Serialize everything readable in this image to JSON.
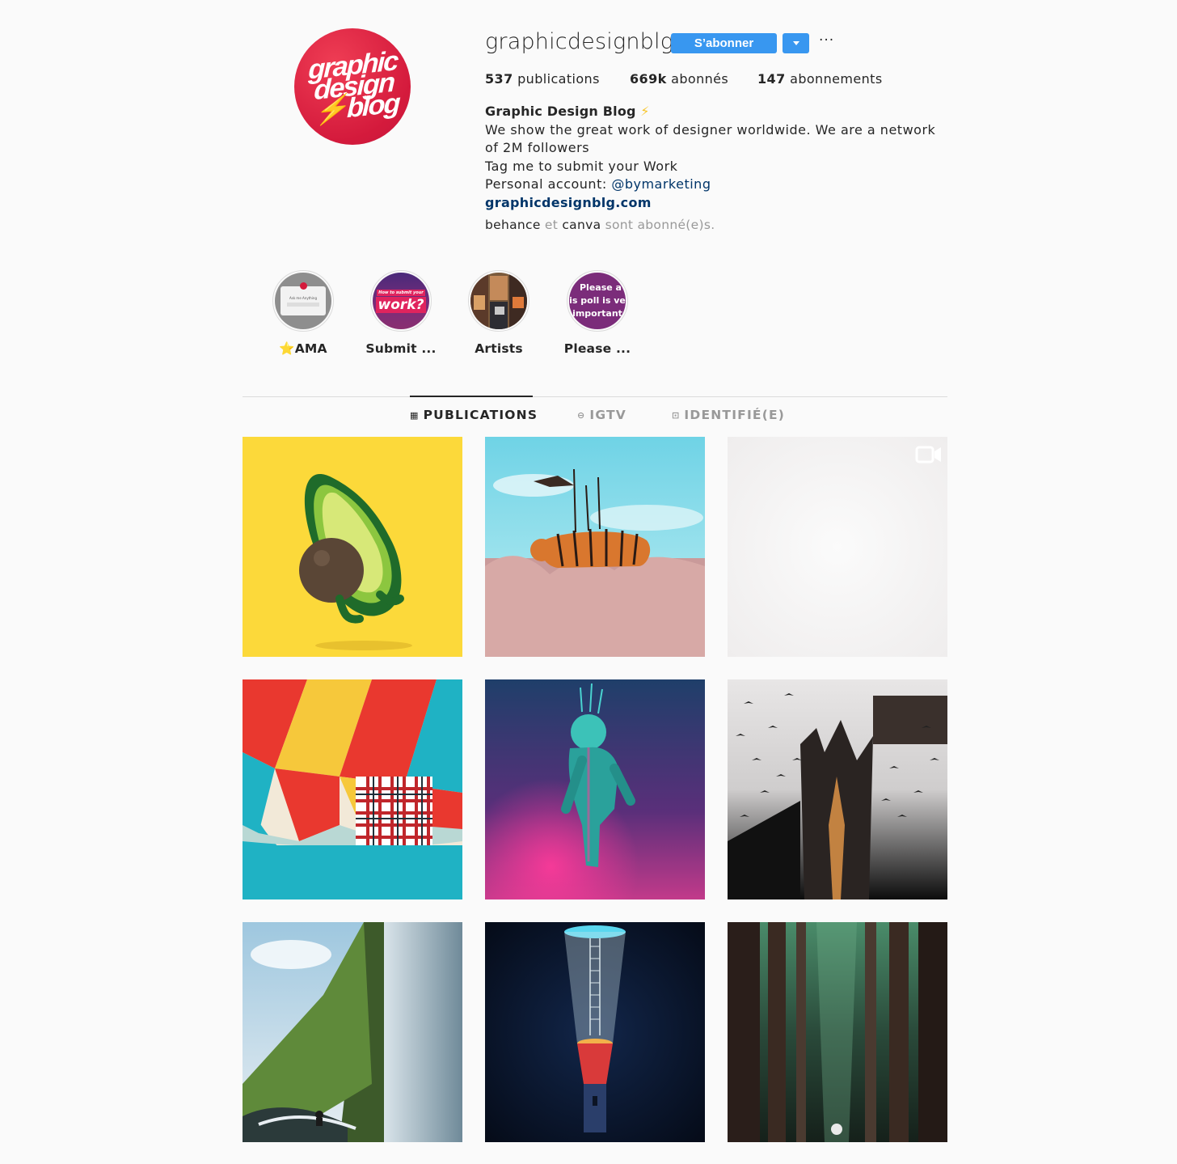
{
  "profile": {
    "avatar_text": [
      "graphic",
      "design",
      "blog"
    ],
    "username": "graphicdesignblg",
    "follow_label": "S’abonner",
    "more_label": "···",
    "stats": {
      "posts_count": "537",
      "posts_label": "publications",
      "followers_count": "669k",
      "followers_label": "abonnés",
      "following_count": "147",
      "following_label": "abonnements"
    },
    "bio": {
      "name": "Graphic Design Blog",
      "name_emoji": "⚡",
      "line1": "We show the great work of designer worldwide. We are a network",
      "line2": "of 2M followers",
      "line3": "Tag me to submit your Work",
      "line4_prefix": "Personal account: ",
      "line4_mention": "@bymarketing",
      "website": "graphicdesignblg.com"
    },
    "followed_by": {
      "user1": "behance",
      "connector": " et ",
      "user2": "canva",
      "suffix": " sont abonné(e)s."
    }
  },
  "highlights": [
    {
      "label": "⭐AMA",
      "cover_text": "Ask me Anything"
    },
    {
      "label": "Submit ...",
      "cover_small": "How to submit your",
      "cover_big": "work?"
    },
    {
      "label": "Artists"
    },
    {
      "label": "Please ...",
      "cover_lines": [
        "Please a",
        "is poll is ve",
        "important"
      ]
    }
  ],
  "tabs": [
    {
      "label": "PUBLICATIONS",
      "icon": "grid-icon",
      "active": true
    },
    {
      "label": "IGTV",
      "icon": "igtv-icon",
      "active": false
    },
    {
      "label": "IDENTIFIÉ(E)",
      "icon": "tagged-icon",
      "active": false
    }
  ],
  "posts": [
    {
      "subject": "avocado-character"
    },
    {
      "subject": "tiger-in-grass"
    },
    {
      "subject": "blank-video",
      "video": true
    },
    {
      "subject": "hot-air-balloon"
    },
    {
      "subject": "astronaut"
    },
    {
      "subject": "city-birds"
    },
    {
      "subject": "waterfall-coast"
    },
    {
      "subject": "glass-tower"
    },
    {
      "subject": "forest"
    }
  ],
  "colors": {
    "accent": "#3897f0",
    "link": "#003569",
    "avatar": "#d41a3c",
    "background": "#fafafa",
    "text": "#262626",
    "muted": "#999999"
  }
}
